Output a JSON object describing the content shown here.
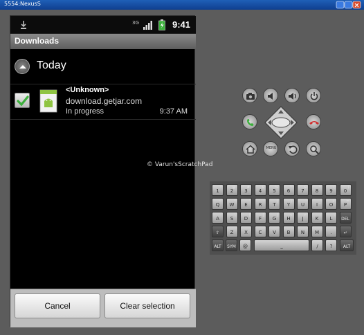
{
  "window": {
    "title": "5554:NexusS"
  },
  "status_bar": {
    "clock": "9:41",
    "network": "3G",
    "icons": [
      "download-notification-icon",
      "signal-bars-icon",
      "battery-charging-icon"
    ]
  },
  "app": {
    "title": "Downloads"
  },
  "group": {
    "label": "Today"
  },
  "download": {
    "name": "<Unknown>",
    "host": "download.getjar.com",
    "status": "In progress",
    "time": "9:37 AM",
    "checked": true
  },
  "buttons": {
    "cancel": "Cancel",
    "clear": "Clear selection"
  },
  "watermark": "© Varun'sScratchPad",
  "controls": {
    "top_row": [
      "camera-icon",
      "volume-down-icon",
      "volume-up-icon",
      "power-icon"
    ],
    "middle_row": [
      "call-icon",
      "dpad",
      "end-call-icon"
    ],
    "bottom_row": [
      "home-icon",
      "menu-icon",
      "back-icon",
      "search-icon"
    ],
    "menu_label": "MENU"
  },
  "keyboard": {
    "row1": [
      [
        "1",
        "!"
      ],
      [
        "2",
        "@"
      ],
      [
        "3",
        "#"
      ],
      [
        "4",
        "$"
      ],
      [
        "5",
        "%"
      ],
      [
        "6",
        "^"
      ],
      [
        "7",
        "&"
      ],
      [
        "8",
        "*"
      ],
      [
        "9",
        "("
      ],
      [
        "0",
        ")"
      ]
    ],
    "row2": [
      [
        "Q",
        "~"
      ],
      [
        "W",
        "\""
      ],
      [
        "E",
        "'"
      ],
      [
        "R",
        ""
      ],
      [
        "T",
        "{"
      ],
      [
        "Y",
        "}"
      ],
      [
        "U",
        "-"
      ],
      [
        "I",
        "_"
      ],
      [
        "O",
        "+"
      ],
      [
        "P",
        "="
      ]
    ],
    "row3": [
      [
        "A",
        ""
      ],
      [
        "S",
        "\\"
      ],
      [
        "D",
        "|"
      ],
      [
        "F",
        "["
      ],
      [
        "G",
        "]"
      ],
      [
        "H",
        "<"
      ],
      [
        "J",
        ">"
      ],
      [
        "K",
        ";"
      ],
      [
        "L",
        ":"
      ],
      [
        "DEL",
        ""
      ]
    ],
    "row4": [
      [
        "⇧",
        ""
      ],
      [
        "Z",
        ""
      ],
      [
        "X",
        ""
      ],
      [
        "C",
        ""
      ],
      [
        "V",
        ""
      ],
      [
        "B",
        ""
      ],
      [
        "N",
        ""
      ],
      [
        "M",
        ""
      ],
      [
        ".",
        ""
      ],
      [
        "↵",
        ""
      ]
    ],
    "row5": {
      "alt_left": "ALT",
      "sym": "SYM",
      "at": "@",
      "space": "⎵",
      "slash": "/",
      "question": "?",
      "comma": ",",
      "alt_right": "ALT"
    }
  },
  "colors": {
    "accent_green": "#3cb03c",
    "end_red": "#d03030",
    "appbar": "#6e6e6e",
    "background": "#5c5c5c"
  }
}
